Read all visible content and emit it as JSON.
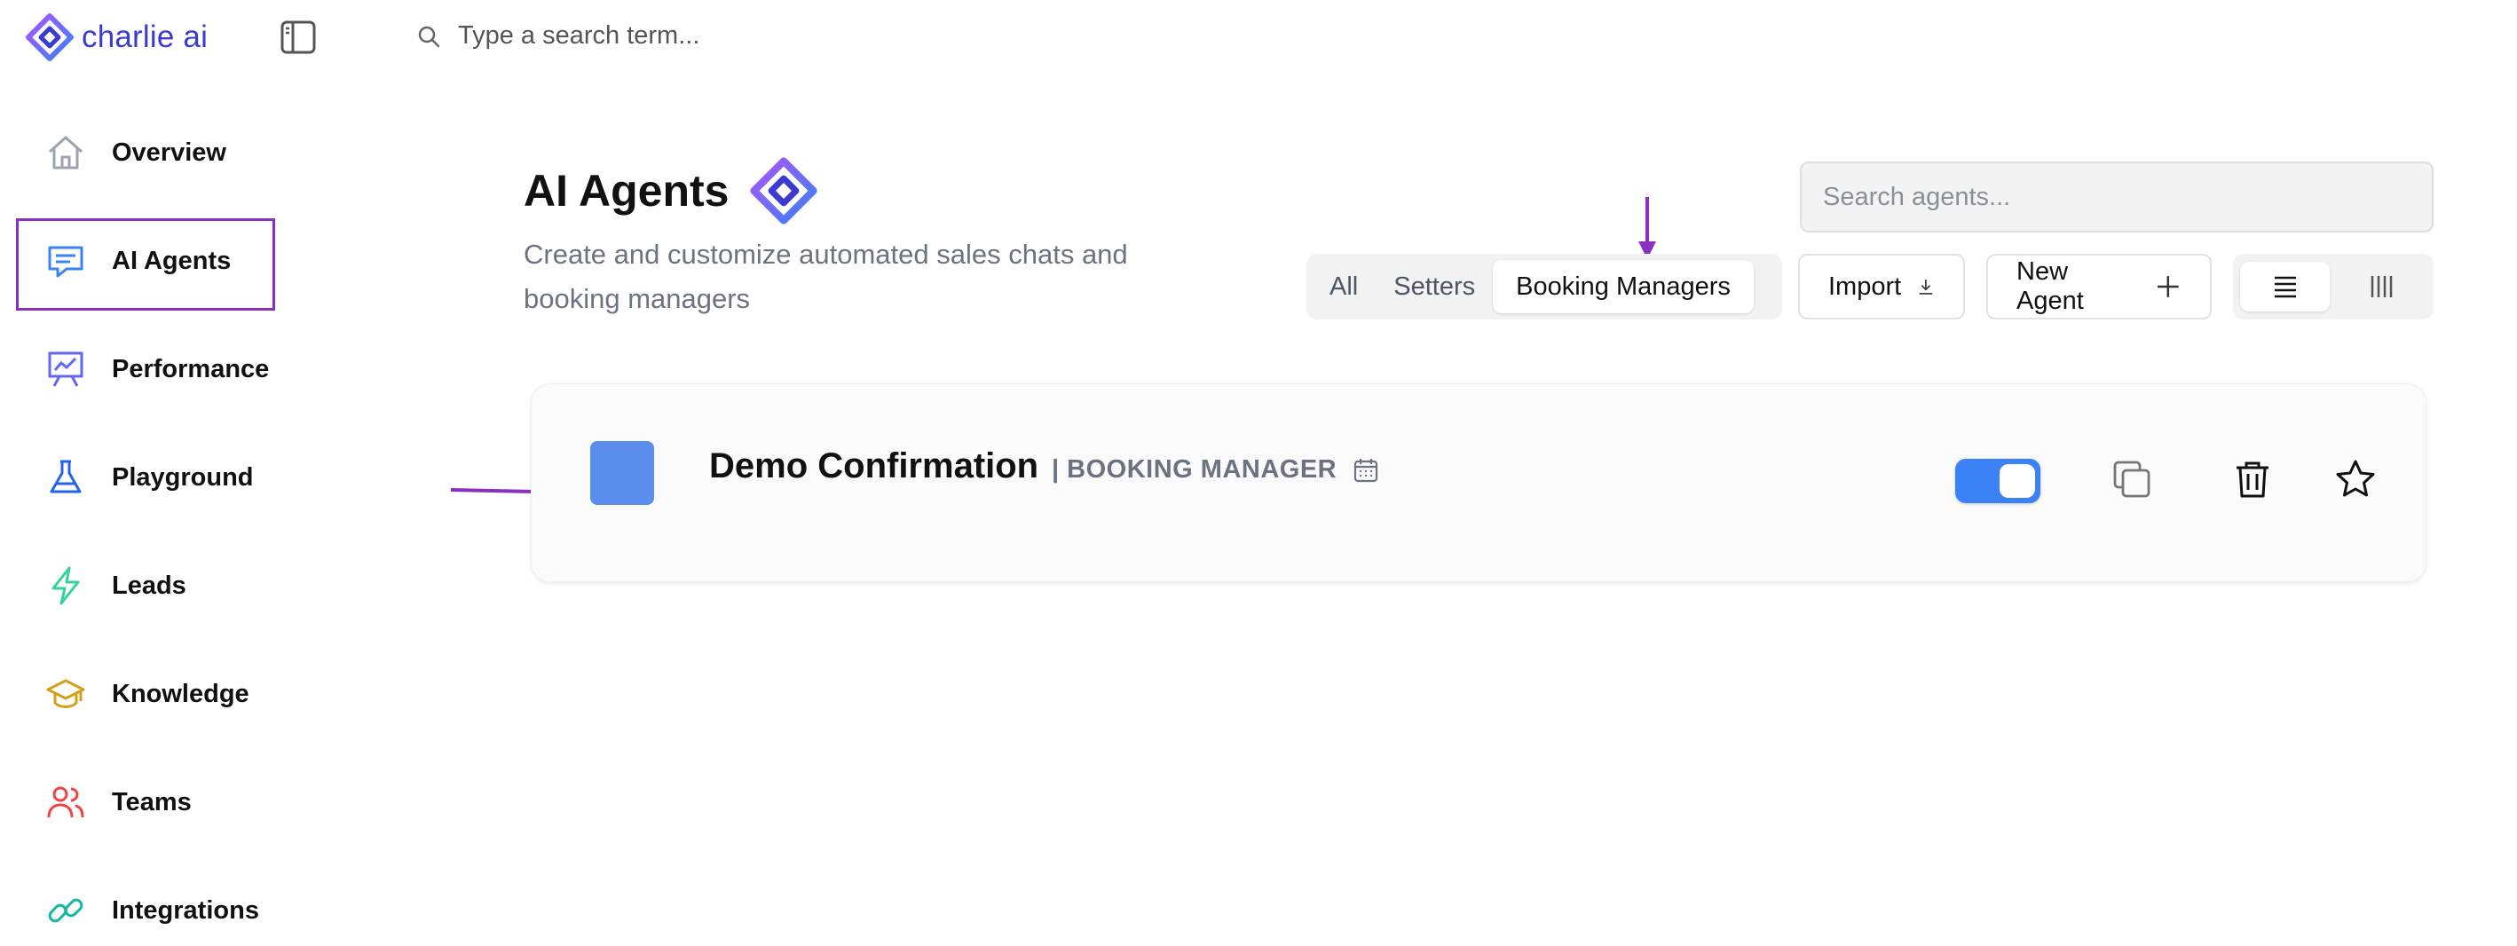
{
  "app": {
    "logo_text": "charlie ai"
  },
  "top_search": {
    "placeholder": "Type a search term..."
  },
  "sidebar": {
    "items": [
      {
        "label": "Overview",
        "icon": "home-icon",
        "color": "#9ca3af"
      },
      {
        "label": "AI Agents",
        "icon": "chat-icon",
        "color": "#3b82f6"
      },
      {
        "label": "Performance",
        "icon": "chart-board-icon",
        "color": "#6366f1"
      },
      {
        "label": "Playground",
        "icon": "flask-icon",
        "color": "#2563eb"
      },
      {
        "label": "Leads",
        "icon": "lightning-icon",
        "color": "#34d399"
      },
      {
        "label": "Knowledge",
        "icon": "graduation-cap-icon",
        "color": "#d4a017"
      },
      {
        "label": "Teams",
        "icon": "users-icon",
        "color": "#ef4444"
      },
      {
        "label": "Integrations",
        "icon": "link-icon",
        "color": "#14b8a6"
      }
    ],
    "active": "AI Agents"
  },
  "header": {
    "title": "AI Agents",
    "subtitle": "Create and customize automated sales chats and booking managers"
  },
  "agent_search": {
    "placeholder": "Search agents..."
  },
  "filter_tabs": {
    "all": "All",
    "setters": "Setters",
    "booking_managers": "Booking Managers",
    "active": "Booking Managers"
  },
  "buttons": {
    "import": "Import",
    "new_agent": "New Agent"
  },
  "view_toggle": {
    "active": "list"
  },
  "agents": [
    {
      "name": "Demo Confirmation",
      "type": "| BOOKING MANAGER",
      "avatar_color": "#5b8def",
      "enabled": true
    }
  ],
  "colors": {
    "accent": "#3b82f6",
    "annotation": "#8a2fbf",
    "brand": "#3b3bd0"
  }
}
